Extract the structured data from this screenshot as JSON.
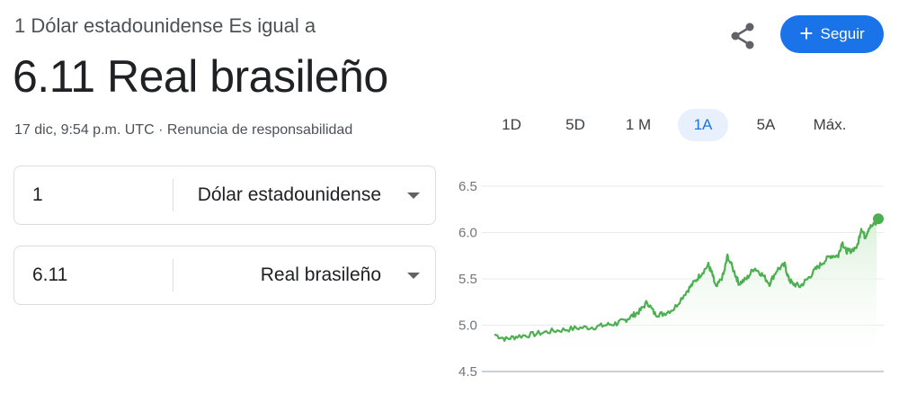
{
  "header": {
    "subtitle": "1 Dólar estadounidense Es igual a",
    "rate": "6.11 Real brasileño",
    "timestamp": "17 dic, 9:54 p.m. UTC",
    "separator": " · ",
    "disclaimer": "Renuncia de responsabilidad",
    "share_icon": "share-icon",
    "follow_label": "Seguir",
    "follow_icon": "plus-icon"
  },
  "colors": {
    "accent": "#1a73e8",
    "line": "#4caf50",
    "fill_top": "#d8efd8"
  },
  "tabs": [
    {
      "label": "1D",
      "active": false
    },
    {
      "label": "5D",
      "active": false
    },
    {
      "label": "1 M",
      "active": false
    },
    {
      "label": "1A",
      "active": true
    },
    {
      "label": "5A",
      "active": false
    },
    {
      "label": "Máx.",
      "active": false
    }
  ],
  "converter": {
    "from": {
      "value": "1",
      "currency": "Dólar estadounidense"
    },
    "to": {
      "value": "6.11",
      "currency": "Real brasileño"
    }
  },
  "chart_data": {
    "type": "line",
    "ylim": [
      4.5,
      6.5
    ],
    "yticks": [
      "6.5",
      "6.0",
      "5.5",
      "5.0",
      "4.5"
    ],
    "x": [
      0,
      0.03,
      0.06,
      0.1,
      0.14,
      0.18,
      0.22,
      0.26,
      0.29,
      0.32,
      0.34,
      0.36,
      0.38,
      0.4,
      0.42,
      0.44,
      0.47,
      0.5,
      0.52,
      0.54,
      0.56,
      0.57,
      0.58,
      0.6,
      0.61,
      0.63,
      0.64,
      0.66,
      0.68,
      0.7,
      0.72,
      0.74,
      0.76,
      0.77,
      0.78,
      0.8,
      0.82,
      0.84,
      0.86,
      0.88,
      0.9,
      0.91,
      0.92,
      0.93,
      0.95,
      0.96,
      0.97,
      0.98,
      1.0
    ],
    "values": [
      4.9,
      4.85,
      4.88,
      4.9,
      4.93,
      4.95,
      4.97,
      4.98,
      5.0,
      5.02,
      5.05,
      5.1,
      5.15,
      5.25,
      5.12,
      5.12,
      5.18,
      5.35,
      5.45,
      5.55,
      5.65,
      5.55,
      5.4,
      5.55,
      5.75,
      5.55,
      5.45,
      5.5,
      5.62,
      5.55,
      5.45,
      5.6,
      5.65,
      5.5,
      5.45,
      5.42,
      5.5,
      5.6,
      5.68,
      5.75,
      5.75,
      5.9,
      5.8,
      5.8,
      5.85,
      6.05,
      5.95,
      6.05,
      6.1
    ]
  }
}
